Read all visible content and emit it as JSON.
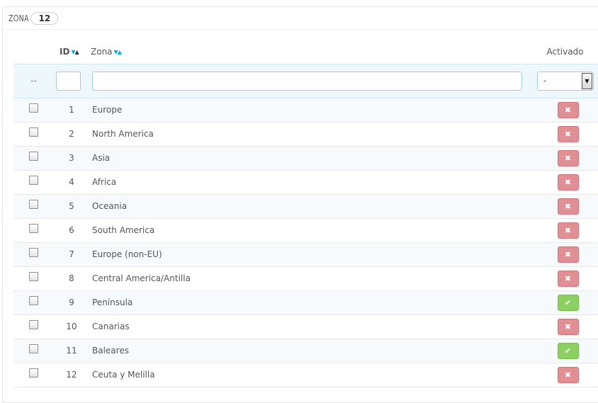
{
  "panel": {
    "title": "ZONA",
    "count": "12"
  },
  "columns": {
    "id": "ID",
    "name": "Zona",
    "active": "Activado"
  },
  "filter": {
    "check_placeholder": "--",
    "id_value": "",
    "name_value": "",
    "active_selected": "-"
  },
  "rows": [
    {
      "id": "1",
      "name": "Europe",
      "active": false
    },
    {
      "id": "2",
      "name": "North America",
      "active": false
    },
    {
      "id": "3",
      "name": "Asia",
      "active": false
    },
    {
      "id": "4",
      "name": "Africa",
      "active": false
    },
    {
      "id": "5",
      "name": "Oceania",
      "active": false
    },
    {
      "id": "6",
      "name": "South America",
      "active": false
    },
    {
      "id": "7",
      "name": "Europe (non-EU)",
      "active": false
    },
    {
      "id": "8",
      "name": "Central America/Antilla",
      "active": false
    },
    {
      "id": "9",
      "name": "Península",
      "active": true
    },
    {
      "id": "10",
      "name": "Canarias",
      "active": false
    },
    {
      "id": "11",
      "name": "Baleares",
      "active": true
    },
    {
      "id": "12",
      "name": "Ceuta y Melilla",
      "active": false
    }
  ],
  "colors": {
    "inactive": "#e08f95",
    "active": "#8ccf62",
    "sort_arrow": "#00aff0",
    "filter_bg": "#edf7fc"
  },
  "icons": {
    "inactive": "close-icon",
    "active": "check-icon"
  }
}
